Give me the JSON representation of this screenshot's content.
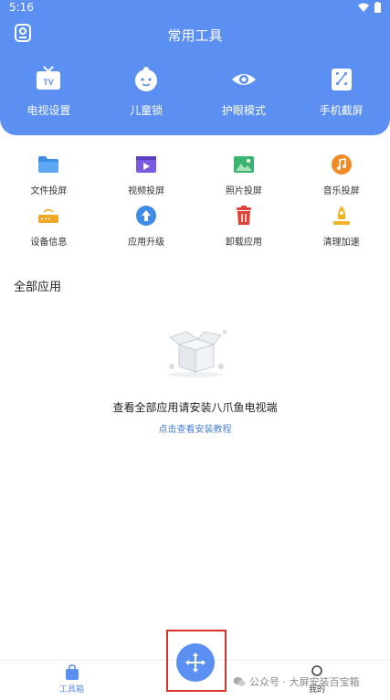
{
  "status": {
    "time": "5:16"
  },
  "header": {
    "title": "常用工具",
    "items": [
      {
        "label": "电视设置",
        "icon": "tv-icon"
      },
      {
        "label": "儿童锁",
        "icon": "child-lock-icon"
      },
      {
        "label": "护眼模式",
        "icon": "eye-icon"
      },
      {
        "label": "手机截屏",
        "icon": "screenshot-icon"
      }
    ]
  },
  "tools": {
    "row1": [
      {
        "label": "文件投屏",
        "icon": "folder-icon"
      },
      {
        "label": "视频投屏",
        "icon": "video-icon"
      },
      {
        "label": "照片投屏",
        "icon": "photo-icon"
      },
      {
        "label": "音乐投屏",
        "icon": "music-icon"
      }
    ],
    "row2": [
      {
        "label": "设备信息",
        "icon": "router-icon"
      },
      {
        "label": "应用升级",
        "icon": "upgrade-icon"
      },
      {
        "label": "卸载应用",
        "icon": "trash-icon"
      },
      {
        "label": "清理加速",
        "icon": "rocket-icon"
      }
    ]
  },
  "apps": {
    "section_title": "全部应用",
    "empty_text": "查看全部应用请安装八爪鱼电视端",
    "empty_link": "点击查看安装教程"
  },
  "nav": {
    "tab_tools": "工具箱",
    "tab_mine": "我的"
  },
  "watermark": {
    "text": "公众号 · 大屏安装百宝箱"
  },
  "colors": {
    "brand": "#5b8ff2",
    "highlight": "#d9322b",
    "link": "#4a7fd6"
  }
}
